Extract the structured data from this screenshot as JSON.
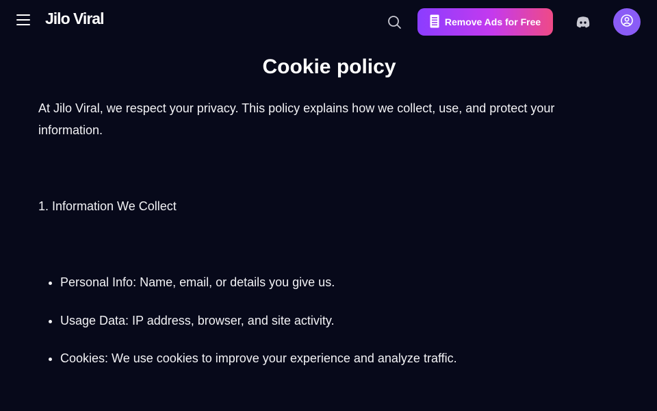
{
  "header": {
    "logo_text": "Jilo Viral",
    "remove_ads_label": "Remove Ads for Free",
    "icons": {
      "menu": "hamburger-menu-icon",
      "search": "search-icon",
      "remove_ads": "document-icon",
      "discord": "discord-icon",
      "account": "user-circle-icon"
    },
    "colors": {
      "button_gradient_start": "#8b3dff",
      "button_gradient_end": "#ef4a86",
      "avatar_bg": "#8a5cf6"
    }
  },
  "main": {
    "title": "Cookie policy",
    "intro": "At Jilo Viral, we respect your privacy. This policy explains how we collect, use, and protect your information.",
    "section_heading": "1. Information We Collect",
    "bullets": [
      "Personal Info: Name, email, or details you give us.",
      "Usage Data: IP address, browser, and site activity.",
      "Cookies: We use cookies to improve your experience and analyze traffic."
    ]
  },
  "colors": {
    "background": "#07091a",
    "text": "#ffffff"
  }
}
